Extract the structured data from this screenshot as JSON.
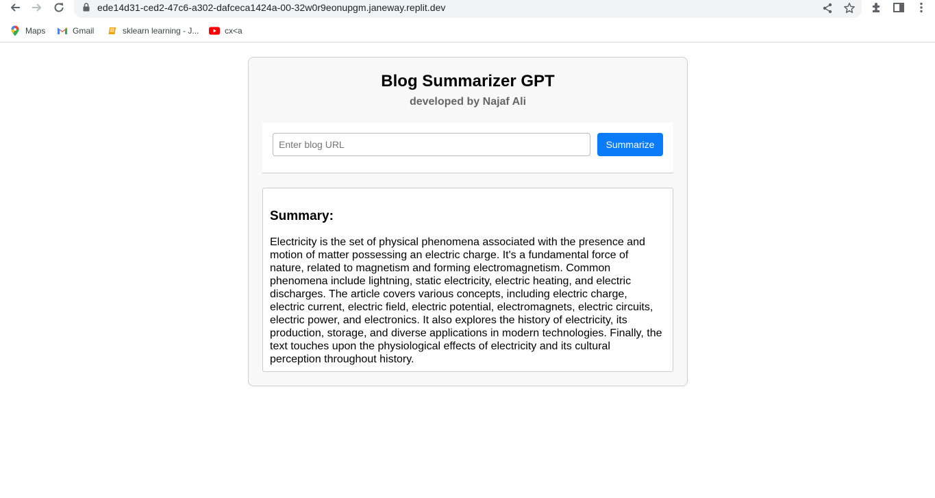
{
  "browser": {
    "url": "ede14d31-ced2-47c6-a302-dafceca1424a-00-32w0r9eonupgm.janeway.replit.dev",
    "bookmarks": [
      {
        "label": "Maps",
        "icon": "maps-icon"
      },
      {
        "label": "Gmail",
        "icon": "gmail-icon"
      },
      {
        "label": "sklearn learning - J...",
        "icon": "book-icon"
      },
      {
        "label": "cx<a",
        "icon": "youtube-icon"
      }
    ]
  },
  "page": {
    "title": "Blog Summarizer GPT",
    "subtitle": "developed by Najaf Ali",
    "form": {
      "input_placeholder": "Enter blog URL",
      "input_value": "",
      "button_label": "Summarize"
    },
    "summary": {
      "heading": "Summary:",
      "text": "Electricity is the set of physical phenomena associated with the presence and motion of matter possessing an electric charge. It's a fundamental force of nature, related to magnetism and forming electromagnetism. Common phenomena include lightning, static electricity, electric heating, and electric discharges. The article covers various concepts, including electric charge, electric current, electric field, electric potential, electromagnets, electric circuits, electric power, and electronics. It also explores the history of electricity, its production, storage, and diverse applications in modern technologies. Finally, the text touches upon the physiological effects of electricity and its cultural perception throughout history."
    }
  },
  "colors": {
    "accent": "#0a7cf7",
    "card_bg": "#f8f8f8",
    "subtitle": "#666666"
  }
}
